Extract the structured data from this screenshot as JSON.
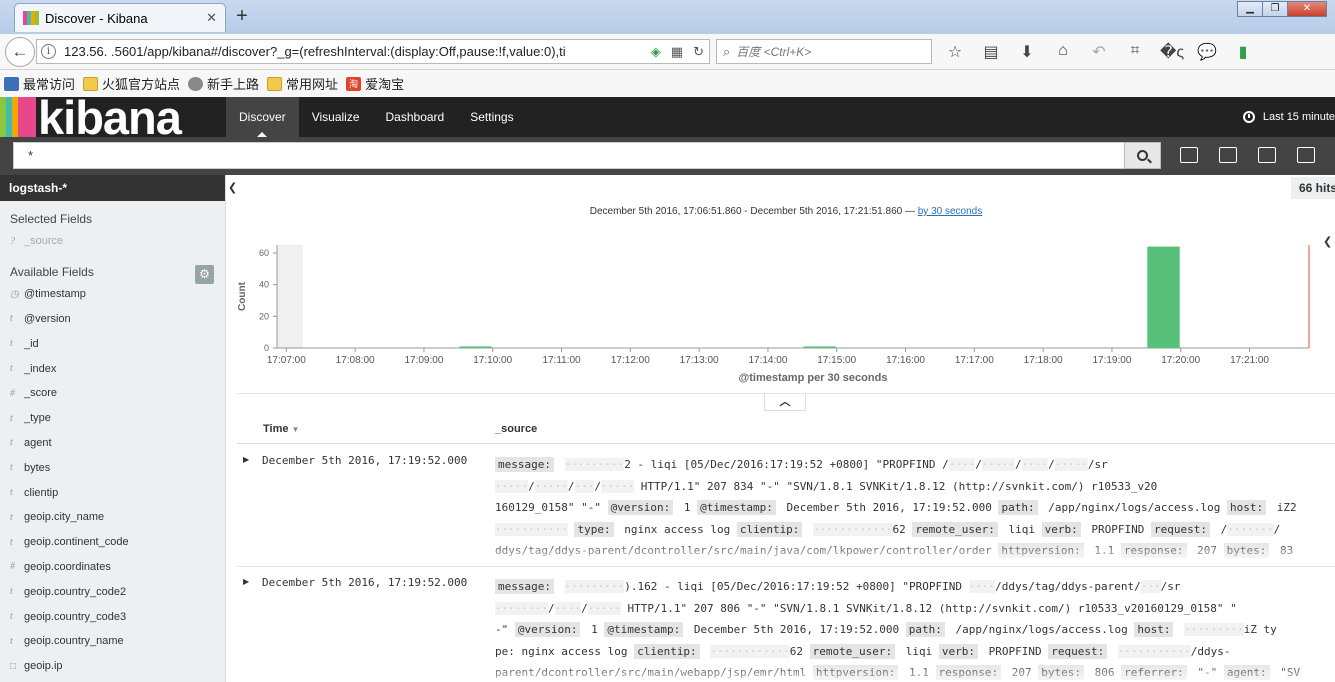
{
  "browser": {
    "tab_title": "Discover - Kibana",
    "url": "123.56.           .5601/app/kibana#/discover?_g=(refreshInterval:(display:Off,pause:!f,value:0),ti",
    "search_placeholder": "百度 <Ctrl+K>"
  },
  "bookmarks": [
    "最常访问",
    "火狐官方站点",
    "新手上路",
    "常用网址",
    "爱淘宝"
  ],
  "kibana": {
    "logo": "kibana",
    "nav_tabs": [
      "Discover",
      "Visualize",
      "Dashboard",
      "Settings"
    ],
    "time_label": "Last 15 minute",
    "query": "*"
  },
  "sidebar": {
    "index_pattern": "logstash-*",
    "selected_title": "Selected Fields",
    "selected_fields": [
      {
        "type": "?",
        "name": "_source"
      }
    ],
    "available_title": "Available Fields",
    "available_fields": [
      {
        "type": "◷",
        "name": "@timestamp"
      },
      {
        "type": "t",
        "name": "@version"
      },
      {
        "type": "t",
        "name": "_id"
      },
      {
        "type": "t",
        "name": "_index"
      },
      {
        "type": "#",
        "name": "_score"
      },
      {
        "type": "t",
        "name": "_type"
      },
      {
        "type": "t",
        "name": "agent"
      },
      {
        "type": "t",
        "name": "bytes"
      },
      {
        "type": "t",
        "name": "clientip"
      },
      {
        "type": "t",
        "name": "geoip.city_name"
      },
      {
        "type": "t",
        "name": "geoip.continent_code"
      },
      {
        "type": "#",
        "name": "geoip.coordinates"
      },
      {
        "type": "t",
        "name": "geoip.country_code2"
      },
      {
        "type": "t",
        "name": "geoip.country_code3"
      },
      {
        "type": "t",
        "name": "geoip.country_name"
      },
      {
        "type": "□",
        "name": "geoip.ip"
      }
    ]
  },
  "main": {
    "hits": "66 hits",
    "range_text": "December 5th 2016, 17:06:51.860 - December 5th 2016, 17:21:51.860 — ",
    "interval_link": "by 30 seconds",
    "table_headers": {
      "time": "Time",
      "source": "_source"
    },
    "rows": [
      {
        "time": "December 5th 2016, 17:19:52.000",
        "lines": [
          "message: ·········2 - liqi [05/Dec/2016:17:19:52 +0800] \"PROPFIND /····/·····/····/·····/sr",
          "·····/·····/···/····· HTTP/1.1\" 207 834 \"-\" \"SVN/1.8.1 SVNKit/1.8.12 (http://svnkit.com/) r10533_v20",
          "160129_0158\" \"-\" @version: 1 @timestamp: December 5th 2016, 17:19:52.000 path: /app/nginx/logs/access.log host: iZ2",
          "··········· type: nginx access log clientip: ············62 remote_user: liqi verb: PROPFIND request: /·······/",
          "ddys/tag/ddys-parent/dcontroller/src/main/java/com/lkpower/controller/order httpversion: 1.1 response: 207 bytes: 83"
        ]
      },
      {
        "time": "December 5th 2016, 17:19:52.000",
        "lines": [
          "message: ·········).162 - liqi [05/Dec/2016:17:19:52 +0800] \"PROPFIND ····/ddys/tag/ddys-parent/···/sr",
          "········/····/····· HTTP/1.1\" 207 806 \"-\" \"SVN/1.8.1 SVNKit/1.8.12 (http://svnkit.com/) r10533_v20160129_0158\" \"",
          "-\" @version: 1 @timestamp: December 5th 2016, 17:19:52.000 path: /app/nginx/logs/access.log host: ·········iZ ty",
          "pe: nginx access log clientip: ············62 remote_user: liqi verb: PROPFIND request: ···········/ddys-",
          "parent/dcontroller/src/main/webapp/jsp/emr/html httpversion: 1.1 response: 207 bytes: 806 referrer: \"-\" agent: \"SV"
        ]
      }
    ]
  },
  "chart_data": {
    "type": "bar",
    "title": "",
    "xlabel": "@timestamp per 30 seconds",
    "ylabel": "Count",
    "ylim": [
      0,
      65
    ],
    "yticks": [
      0,
      20,
      40,
      60
    ],
    "xticks": [
      "17:07:00",
      "17:08:00",
      "17:09:00",
      "17:10:00",
      "17:11:00",
      "17:12:00",
      "17:13:00",
      "17:14:00",
      "17:15:00",
      "17:16:00",
      "17:17:00",
      "17:18:00",
      "17:19:00",
      "17:20:00",
      "17:21:00"
    ],
    "x_domain_min": "17:06:51.860",
    "x_domain_max": "17:21:51.860",
    "bars": [
      {
        "x": "17:09:30",
        "value": 1
      },
      {
        "x": "17:14:30",
        "value": 1
      },
      {
        "x": "17:19:30",
        "value": 64
      }
    ],
    "colors": {
      "bar": "#57c17b",
      "shade": "#f0f0f0",
      "now_line": "#e74c3c"
    }
  }
}
